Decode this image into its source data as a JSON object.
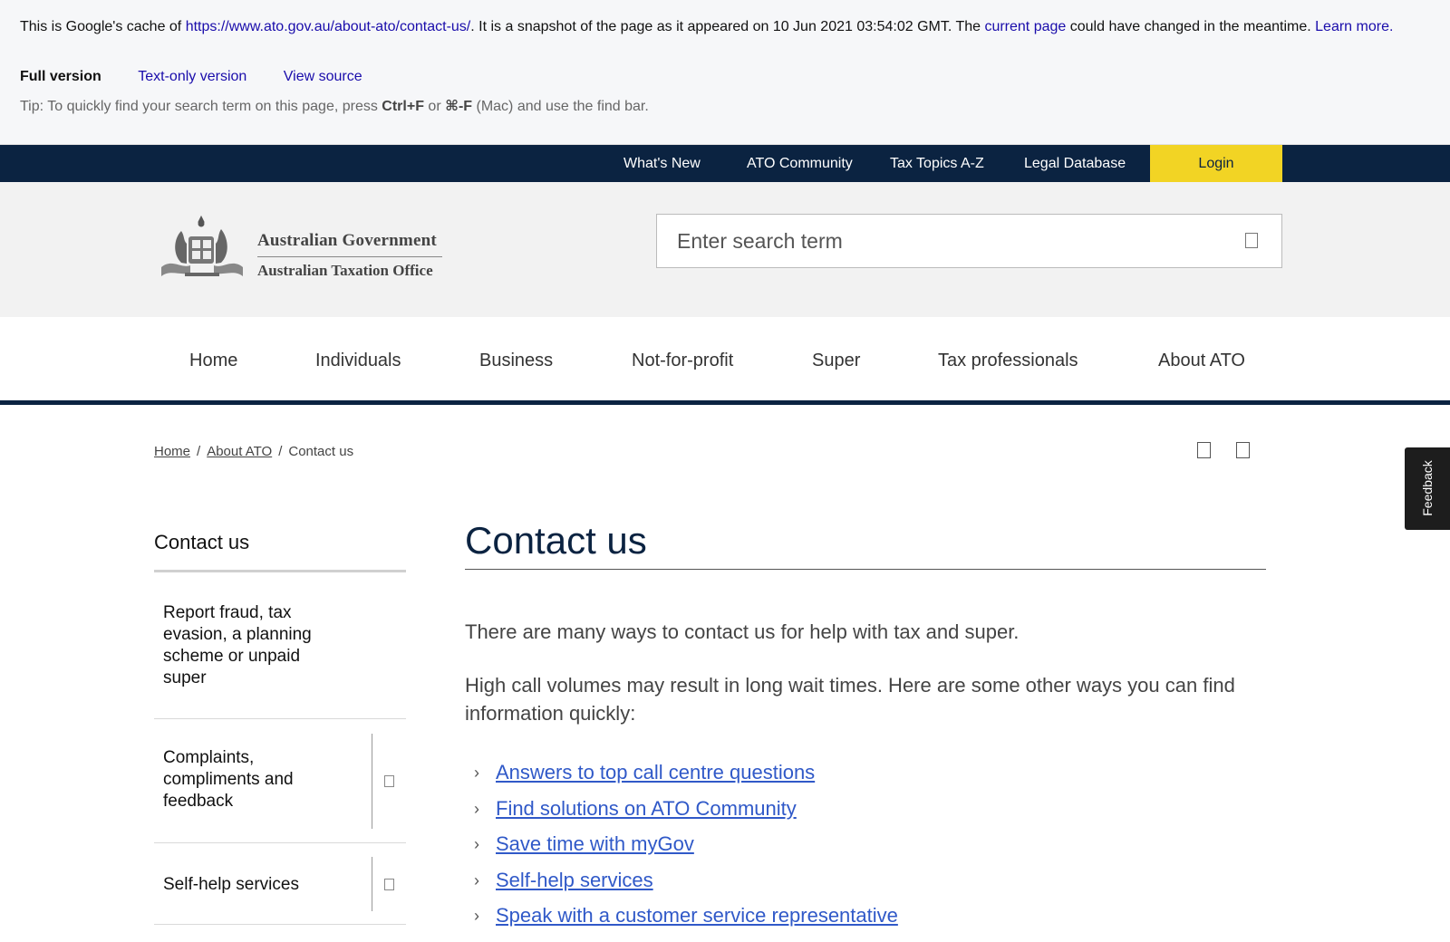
{
  "cache_banner": {
    "text_1": "This is Google's cache of ",
    "cached_url": "https://www.ato.gov.au/about-ato/contact-us/",
    "text_2": ". It is a snapshot of the page as it appeared on 10 Jun 2021 03:54:02 GMT. The ",
    "current_page_link": "current page",
    "text_3": " could have changed in the meantime. ",
    "learn_more_link": "Learn more.",
    "version_links": [
      "Full version",
      "Text-only version",
      "View source"
    ],
    "tip_1": "Tip: To quickly find your search term on this page, press ",
    "tip_key_1": "Ctrl+F",
    "tip_2": " or ",
    "tip_key_2": "⌘-F",
    "tip_3": " (Mac) and use the find bar."
  },
  "util_bar": {
    "items": [
      "What's New",
      "ATO Community",
      "Tax Topics A-Z",
      "Legal Database"
    ],
    "login_label": "Login"
  },
  "header": {
    "logo_line_1": "Australian Government",
    "logo_line_2": "Australian Taxation Office",
    "search_placeholder": "Enter search term"
  },
  "main_nav": {
    "items": [
      "Home",
      "Individuals",
      "Business",
      "Not-for-profit",
      "Super",
      "Tax professionals",
      "About ATO"
    ]
  },
  "breadcrumb": {
    "items": [
      "Home",
      "About ATO",
      "Contact us"
    ],
    "separator": "/"
  },
  "feedback_label": "Feedback",
  "side_menu": {
    "heading": "Contact us",
    "items": [
      "Report fraud, tax evasion, a planning scheme or unpaid super",
      "Complaints, compliments and feedback",
      "Self-help services"
    ]
  },
  "content": {
    "title": "Contact us",
    "intro": "There are many ways to contact us for help with tax and super.",
    "para_2": "High call volumes may result in long wait times. Here are some other ways you can find information quickly:",
    "chevron": "›",
    "links": [
      "Answers to top call centre questions",
      "Find solutions on ATO Community",
      "Save time with myGov",
      "Self-help services",
      "Speak with a customer service representative"
    ]
  },
  "colors": {
    "brand_navy": "#0b2341",
    "login_yellow": "#f2d424",
    "link_blue": "#3059c8"
  }
}
